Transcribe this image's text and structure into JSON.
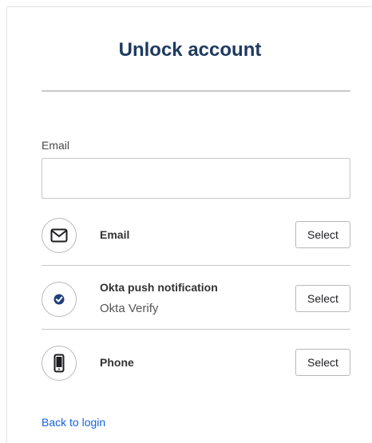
{
  "title": "Unlock account",
  "email_field": {
    "label": "Email",
    "value": "",
    "placeholder": ""
  },
  "factors": [
    {
      "name": "Email",
      "subtitle": "",
      "icon": "envelope-icon",
      "button_label": "Select"
    },
    {
      "name": "Okta push notification",
      "subtitle": "Okta Verify",
      "icon": "okta-verify-icon",
      "button_label": "Select"
    },
    {
      "name": "Phone",
      "subtitle": "",
      "icon": "phone-icon",
      "button_label": "Select"
    }
  ],
  "back_link": "Back to login",
  "colors": {
    "title": "#1e3a5f",
    "link": "#1662dd",
    "okta_verify": "#1f3e7a"
  }
}
